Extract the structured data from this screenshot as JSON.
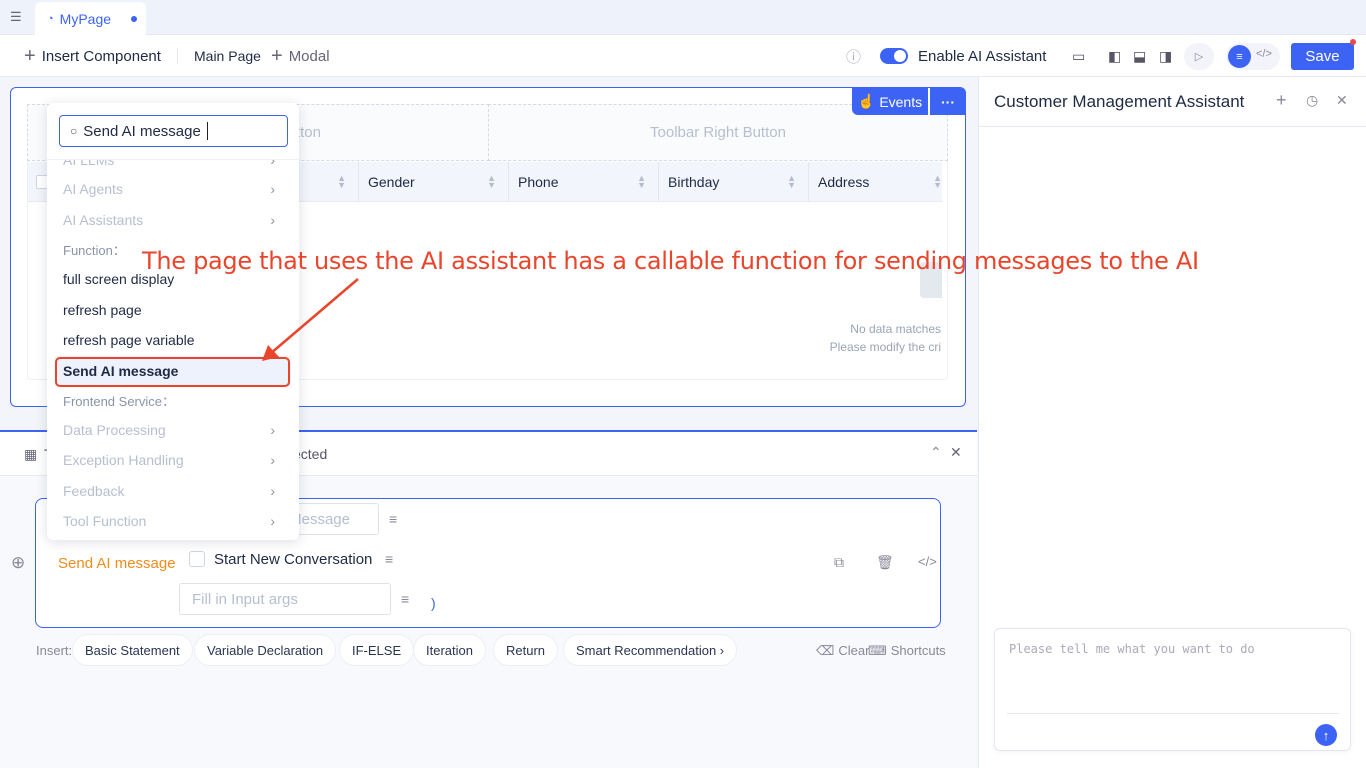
{
  "tabs": {
    "active": "MyPage"
  },
  "toolbar": {
    "insert_component": "Insert Component",
    "main_page": "Main Page",
    "modal": "Modal",
    "enable_ai": "Enable AI Assistant",
    "save": "Save"
  },
  "canvas": {
    "events": "Events",
    "more": "···",
    "toolbar_left": "Toolbar Left Button",
    "toolbar_right": "Toolbar Right Button",
    "columns": [
      "Gender",
      "Phone",
      "Birthday",
      "Address"
    ],
    "empty_line1": "No data matches",
    "empty_line2": "Please modify the cri"
  },
  "dropdown": {
    "search_value": "Send AI message",
    "ai_items": [
      "AI LLMs",
      "AI Agents",
      "AI Assistants"
    ],
    "function_label": "Function：",
    "function_items": [
      "full screen display",
      "refresh page",
      "refresh page variable",
      "Send AI message"
    ],
    "frontend_label": "Frontend Service：",
    "frontend_items": [
      "Data Processing",
      "Exception Handling",
      "Feedback",
      "Tool Function"
    ]
  },
  "bottom": {
    "header_left": "T",
    "header_right": "ected",
    "function_name": "Send AI message",
    "message_placeholder": "Message",
    "start_new": "Start New Conversation",
    "args_placeholder": "Fill in Input args",
    "close_paren": ")",
    "insert_label": "Insert:",
    "chips": [
      "Basic Statement",
      "Variable Declaration",
      "IF-ELSE",
      "Iteration",
      "Return",
      "Smart Recommendation ›"
    ],
    "clear": "Clear",
    "shortcuts": "Shortcuts"
  },
  "assistant": {
    "title": "Customer Management Assistant",
    "input_placeholder": "Please tell me what you want to do"
  },
  "annotation": "The page that uses the AI assistant has a callable function for sending messages to the AI",
  "colors": {
    "accent": "#3d63f5",
    "annotation": "#e8452c",
    "function": "#f08c1a"
  }
}
